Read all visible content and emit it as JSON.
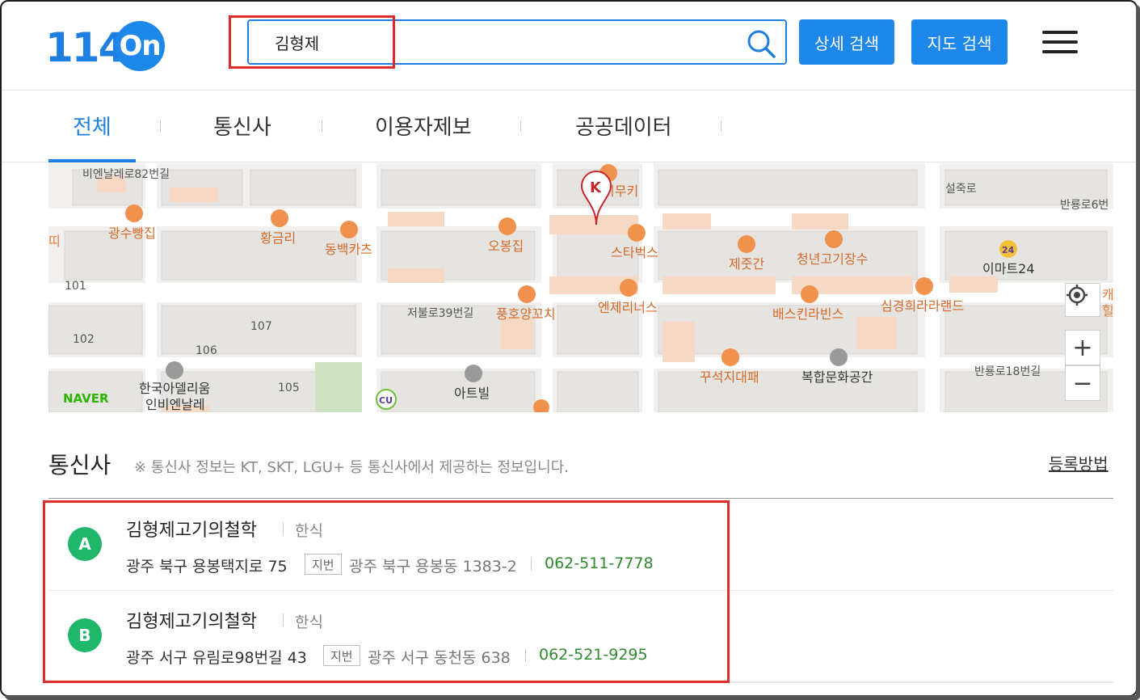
{
  "header": {
    "logo_num": "114",
    "logo_on": "On",
    "search_value": "김형제",
    "detail_search_label": "상세 검색",
    "map_search_label": "지도 검색"
  },
  "tabs": [
    {
      "label": "전체",
      "active": true
    },
    {
      "label": "통신사",
      "active": false
    },
    {
      "label": "이용자제보",
      "active": false
    },
    {
      "label": "공공데이터",
      "active": false
    }
  ],
  "map": {
    "labels": {
      "street1": "비엔날레로82번길",
      "poi_kimukki": "키무키",
      "poi_gwangsu": "광수빵집",
      "poi_hwanggeumri": "황금리",
      "poi_dongbaek": "동백카츠",
      "poi_obong": "오봉집",
      "poi_starbucks": "스타벅스",
      "poi_jejugan": "제줏간",
      "poi_cheongnyeon": "청년고기장수",
      "poi_emart": "이마트24",
      "street2": "설죽로",
      "street3": "반룡로6번",
      "num101": "101",
      "num102": "102",
      "num106": "106",
      "num107": "107",
      "num105": "105",
      "street4": "저불로39번길",
      "poi_punghoyang": "풍호양꼬치",
      "poi_enjeri": "엔제리너스",
      "poi_baskin": "배스킨라빈스",
      "poi_simgyeong": "심경희라라랜드",
      "poi_kkuseok": "꾸석지대패",
      "poi_bokhap": "복합문화공간",
      "poi_academy": "한국아델리움",
      "poi_academy2": "인비엔날레",
      "poi_artbil": "아트빌",
      "street5": "반룡로18번길",
      "edge_left": "띠",
      "edge_right1": "캐",
      "edge_right2": "힐",
      "cu": "CU",
      "naver": "NAVER",
      "marker": "K",
      "emart_badge": "24"
    },
    "zoom_in": "+",
    "zoom_out": "−"
  },
  "section": {
    "title": "통신사",
    "note": "※ 통신사 정보는 KT, SKT, LGU+ 등 통신사에서 제공하는 정보입니다.",
    "register_link": "등록방법"
  },
  "results": [
    {
      "marker": "A",
      "name": "김형제고기의철학",
      "category": "한식",
      "road_address": "광주 북구 용봉택지로 75",
      "badge": "지번",
      "jibun_address": "광주 북구 용봉동 1383-2",
      "phone": "062-511-7778"
    },
    {
      "marker": "B",
      "name": "김형제고기의철학",
      "category": "한식",
      "road_address": "광주 서구 유림로98번길 43",
      "badge": "지번",
      "jibun_address": "광주 서구 동천동 638",
      "phone": "062-521-9295"
    }
  ],
  "colors": {
    "brand_blue": "#1e88ea",
    "highlight_red": "#e12b2b",
    "marker_green": "#1fb86b",
    "phone_green": "#2f8a2f",
    "poi_orange": "#e47b3c"
  }
}
